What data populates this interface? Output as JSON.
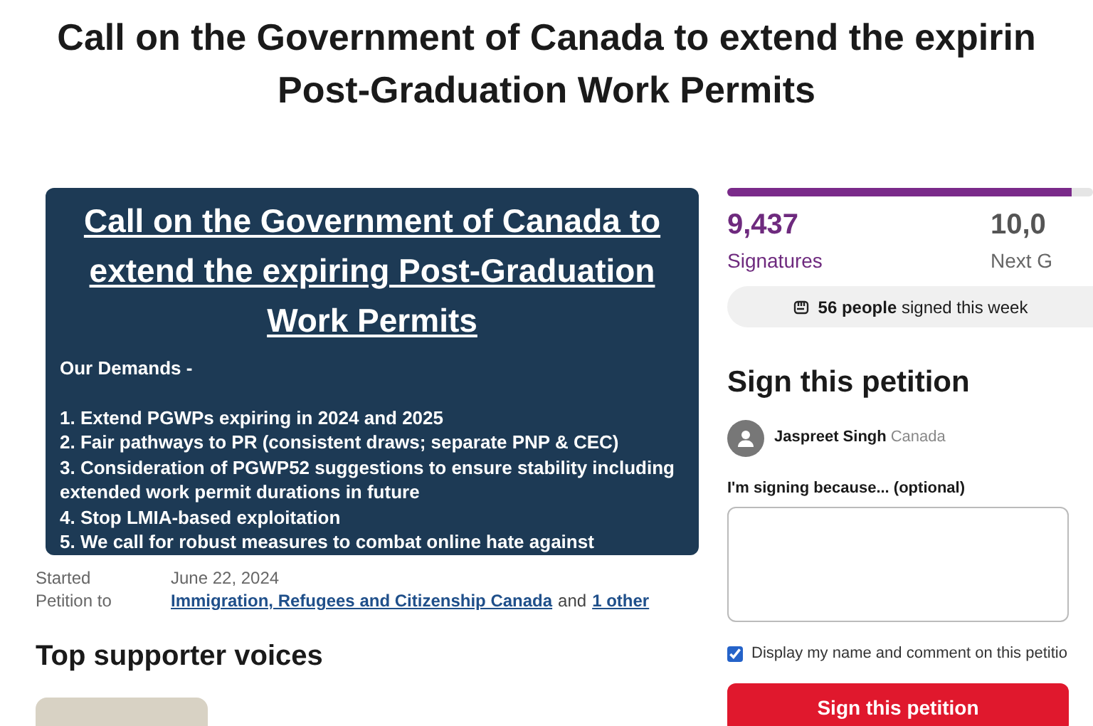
{
  "title": [
    "Call on the Government of Canada to extend the expirin",
    "Post-Graduation Work Permits"
  ],
  "poster": {
    "heading": "Call on the Government of Canada to extend the expiring Post-Graduation Work Permits",
    "subheading": "Our Demands -",
    "demands": [
      "1. Extend PGWPs expiring in 2024 and 2025",
      "2. Fair pathways to PR (consistent draws; separate PNP & CEC)",
      "3. Consideration of PGWP52 suggestions to ensure stability including extended work permit durations in future",
      "4. Stop LMIA-based exploitation",
      "5. We call for robust measures to combat online hate against"
    ]
  },
  "details": {
    "started_label": "Started",
    "started_value": "June 22, 2024",
    "to_label": "Petition to",
    "to_link": "Immigration, Refugees and Citizenship Canada",
    "to_joiner": "and",
    "to_other": "1 other"
  },
  "supporters": {
    "heading": "Top supporter voices"
  },
  "progress": {
    "level": 0.94,
    "count": "9,437",
    "count_label": "Signatures",
    "goal": "10,0",
    "goal_label": "Next G"
  },
  "weekly": "**56 people** signed this week",
  "sign": {
    "heading": "Sign this petition",
    "user_name": "Jaspreet Singh",
    "user_country": "Canada",
    "reason_label": "I'm signing because... (optional)",
    "display_checkbox": {
      "label": "Display my name and comment on this petitio",
      "checked": true
    },
    "button": "Sign this petition"
  }
}
